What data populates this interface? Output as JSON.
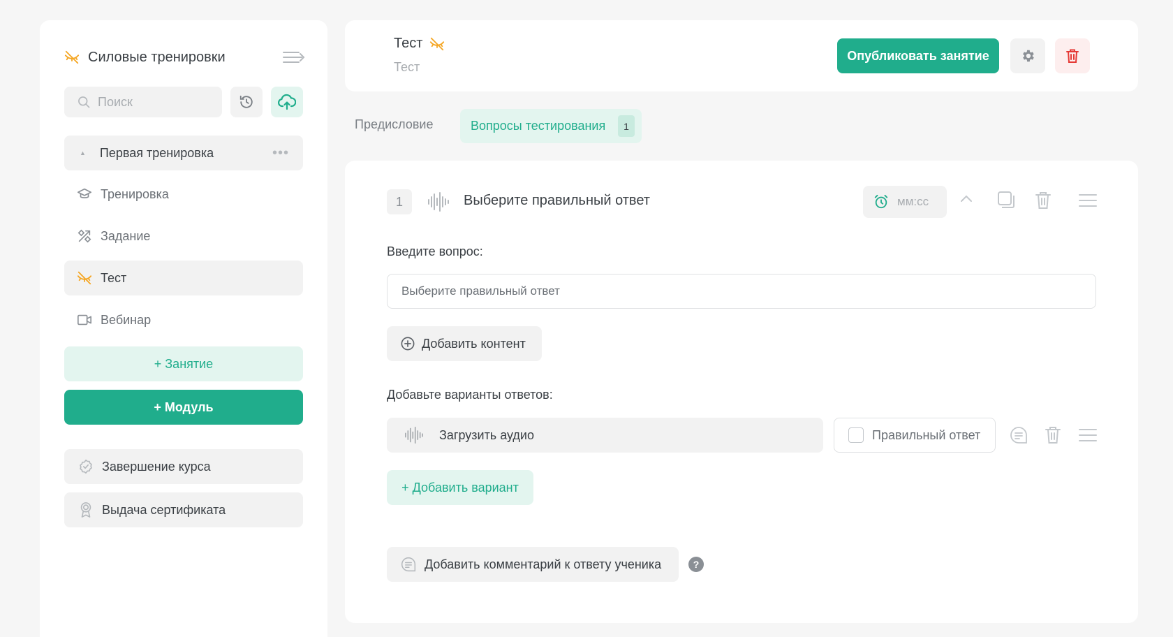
{
  "sidebar": {
    "course_title": "Силовые тренировки",
    "search_placeholder": "Поиск",
    "module": {
      "title": "Первая тренировка",
      "more": "•••"
    },
    "lessons": [
      {
        "label": "Тренировка",
        "icon": "graduation-cap-icon",
        "active": false
      },
      {
        "label": "Задание",
        "icon": "tools-icon",
        "active": false
      },
      {
        "label": "Тест",
        "icon": "hidden-eye-icon",
        "active": true
      },
      {
        "label": "Вебинар",
        "icon": "video-camera-icon",
        "active": false
      }
    ],
    "add_lesson_label": "+ Занятие",
    "add_module_label": "+ Модуль",
    "course_completion_label": "Завершение курса",
    "certificate_label": "Выдача сертификата"
  },
  "header": {
    "title": "Тест",
    "subtitle": "Тест",
    "publish_label": "Опубликовать занятие"
  },
  "tabs": {
    "preface_label": "Предисловие",
    "questions_label": "Вопросы тестирования",
    "questions_count": "1"
  },
  "question": {
    "number": "1",
    "title": "Выберите правильный ответ",
    "timer_placeholder": "мм:сс",
    "question_label": "Введите вопрос:",
    "question_value": "Выберите правильный ответ",
    "add_content_label": "Добавить контент",
    "answers_label": "Добавьте варианты ответов:",
    "upload_audio_label": "Загрузить аудио",
    "correct_answer_label": "Правильный ответ",
    "add_variant_label": "+ Добавить вариант",
    "add_comment_label": "Добавить комментарий к ответу ученика",
    "help_mark": "?"
  },
  "colors": {
    "accent": "#20ad8c",
    "accent_light": "#e3f5ef",
    "warning_icon": "#f5a623",
    "danger": "#e53935",
    "background": "#f6f6f6"
  }
}
